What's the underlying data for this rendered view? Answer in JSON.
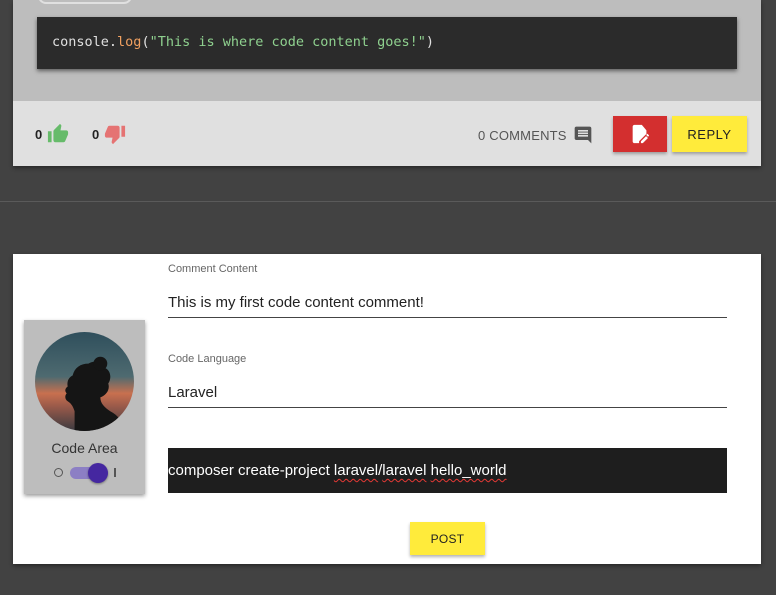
{
  "post": {
    "code": {
      "object": "console",
      "dot": ".",
      "method": "log",
      "open": "(",
      "string": "\"This is where code content goes!\"",
      "close": ")"
    },
    "likes": "0",
    "dislikes": "0",
    "comments_label": "0 COMMENTS",
    "reply_label": "REPLY",
    "icons": {
      "like": "thumb-up-icon",
      "dislike": "thumb-down-icon",
      "comments": "comment-icon",
      "edit": "edit-note-icon"
    },
    "colors": {
      "like": "#66bb6a",
      "dislike": "#e57373",
      "edit_button": "#d32f2f",
      "reply_button": "#ffeb3b"
    }
  },
  "form": {
    "avatar_label": "Code Area",
    "code_area_switch_on": true,
    "comment_content": {
      "label": "Comment Content",
      "value": "This is my first code content comment!"
    },
    "code_language": {
      "label": "Code Language",
      "value": "Laravel"
    },
    "code": {
      "part1": "composer create-project ",
      "part2": "laravel",
      "part3": "/",
      "part4": "laravel",
      "part5": " ",
      "part6": "hello_world"
    },
    "post_label": "POST",
    "colors": {
      "switch_accent": "#4527a0",
      "post_button": "#ffeb3b"
    }
  }
}
